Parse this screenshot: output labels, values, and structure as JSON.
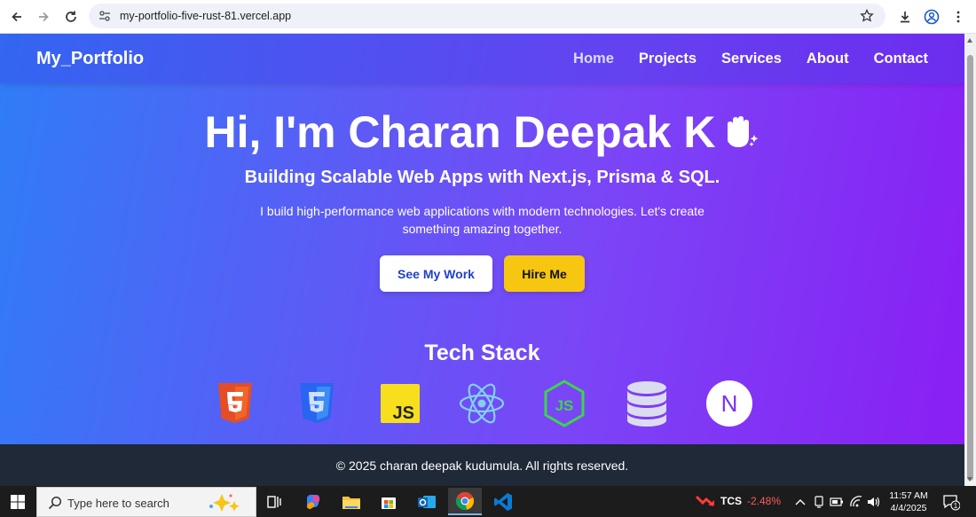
{
  "browser": {
    "url": "my-portfolio-five-rust-81.vercel.app",
    "back_icon": "arrow-left-icon",
    "forward_icon": "arrow-right-icon",
    "reload_icon": "reload-icon",
    "site_info_icon": "tune-icon",
    "bookmark_icon": "star-icon",
    "download_icon": "download-icon",
    "profile_icon": "profile-icon",
    "menu_icon": "kebab-menu-icon"
  },
  "site": {
    "logo": "My_Portfolio",
    "nav": [
      "Home",
      "Projects",
      "Services",
      "About",
      "Contact"
    ],
    "active_nav": "Home",
    "hero": {
      "title": "Hi, I'm Charan Deepak K",
      "subtitle": "Building Scalable Web Apps with Next.js, Prisma & SQL.",
      "description": "I build high-performance web applications with modern technologies. Let's create something amazing together.",
      "primary_button": "See My Work",
      "secondary_button": "Hire Me"
    },
    "tech_stack": {
      "title": "Tech Stack",
      "icons": [
        "html5-icon",
        "css3-icon",
        "javascript-icon",
        "react-icon",
        "nodejs-icon",
        "database-icon",
        "nextjs-icon"
      ],
      "js_label": "JS",
      "node_label": "JS",
      "next_label": "N"
    },
    "footer": "© 2025 charan deepak kudumula. All rights reserved."
  },
  "colors": {
    "gradient_start": "#2f7df7",
    "gradient_end": "#8a1ef4",
    "hire_button": "#f6c610",
    "footer_bg": "#1f2937",
    "see_work_text": "#2140c8"
  },
  "taskbar": {
    "search_placeholder": "Type here to search",
    "stock_name": "TCS",
    "stock_change": "-2.48%",
    "time": "11:57 AM",
    "date": "4/4/2025",
    "notification_count": "1"
  }
}
